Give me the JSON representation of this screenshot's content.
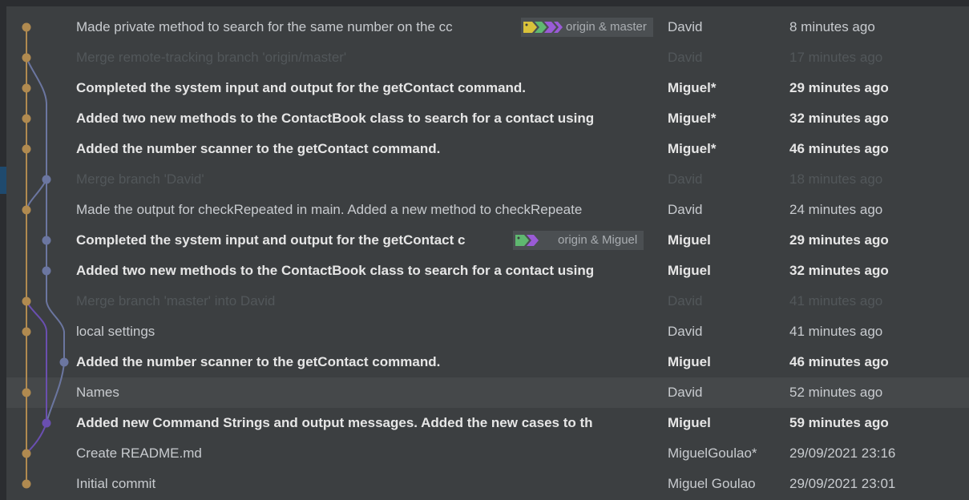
{
  "colors": {
    "background": "#3c3f41",
    "branch_master": "#b08a50",
    "branch_miguel": "#6b76a0",
    "branch_david": "#6a4fb0",
    "tag_yellow": "#d9c23a",
    "tag_green": "#5fb870",
    "tag_purple": "#9a5bd6"
  },
  "commits": [
    {
      "message": "Made private method to search for the same number on the cc",
      "author": "David",
      "date": "8 minutes ago",
      "style": "normal",
      "tag": "origin & master"
    },
    {
      "message": "Merge remote-tracking branch 'origin/master'",
      "author": "David",
      "date": "17 minutes ago",
      "style": "merge"
    },
    {
      "message": "Completed the system input and output for the getContact command.",
      "author": "Miguel*",
      "date": "29 minutes ago",
      "style": "bold"
    },
    {
      "message": "Added two new methods to the ContactBook class to search for a contact using",
      "author": "Miguel*",
      "date": "32 minutes ago",
      "style": "bold"
    },
    {
      "message": "Added the number scanner to the getContact command.",
      "author": "Miguel*",
      "date": "46 minutes ago",
      "style": "bold"
    },
    {
      "message": "Merge branch 'David'",
      "author": "David",
      "date": "18 minutes ago",
      "style": "merge"
    },
    {
      "message": "Made the output for checkRepeated in main. Added a new method to checkRepeate",
      "author": "David",
      "date": "24 minutes ago",
      "style": "normal"
    },
    {
      "message": "Completed the system input and output for the getContact c",
      "author": "Miguel",
      "date": "29 minutes ago",
      "style": "bold",
      "tag": "origin & Miguel"
    },
    {
      "message": "Added two new methods to the ContactBook class to search for a contact using",
      "author": "Miguel",
      "date": "32 minutes ago",
      "style": "bold"
    },
    {
      "message": "Merge branch 'master' into David",
      "author": "David",
      "date": "41 minutes ago",
      "style": "merge"
    },
    {
      "message": "local settings",
      "author": "David",
      "date": "41 minutes ago",
      "style": "normal"
    },
    {
      "message": "Added the number scanner to the getContact command.",
      "author": "Miguel",
      "date": "46 minutes ago",
      "style": "bold"
    },
    {
      "message": "Names",
      "author": "David",
      "date": "52 minutes ago",
      "style": "normal",
      "highlight": true
    },
    {
      "message": "Added new Command Strings and output messages. Added the new cases to th",
      "author": "Miguel",
      "date": "59 minutes ago",
      "style": "bold"
    },
    {
      "message": "Create README.md",
      "author": "MiguelGoulao*",
      "date": "29/09/2021 23:16",
      "style": "normal"
    },
    {
      "message": "Initial commit",
      "author": "Miguel Goulao",
      "date": "29/09/2021 23:01",
      "style": "normal"
    }
  ]
}
